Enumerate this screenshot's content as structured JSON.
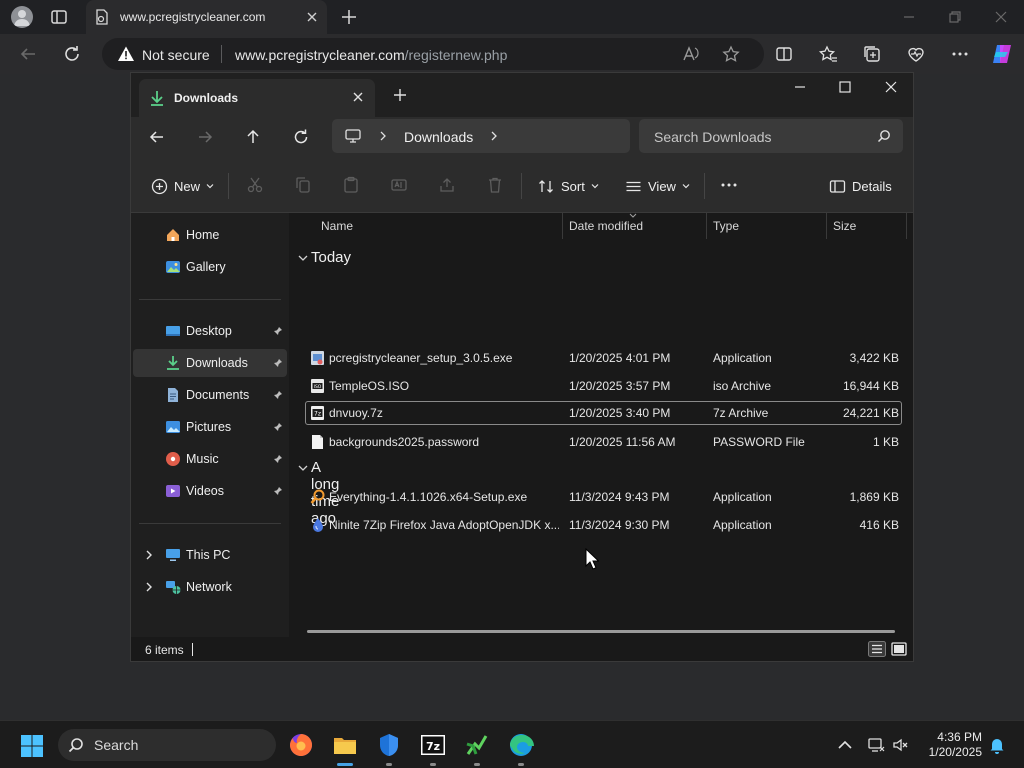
{
  "browser": {
    "tab_title": "www.pcregistrycleaner.com",
    "security_label": "Not secure",
    "url_host": "www.pcregistrycleaner.com",
    "url_path": "/registernew.php"
  },
  "explorer": {
    "tab_title": "Downloads",
    "breadcrumb": "Downloads",
    "search_placeholder": "Search Downloads",
    "toolbar": {
      "new_label": "New",
      "sort_label": "Sort",
      "view_label": "View",
      "details_label": "Details"
    },
    "sidebar": {
      "quick": [
        {
          "label": "Home",
          "icon": "home-icon"
        },
        {
          "label": "Gallery",
          "icon": "gallery-icon"
        }
      ],
      "pinned": [
        {
          "label": "Desktop",
          "icon": "desktop-icon"
        },
        {
          "label": "Downloads",
          "icon": "downloads-icon"
        },
        {
          "label": "Documents",
          "icon": "documents-icon"
        },
        {
          "label": "Pictures",
          "icon": "pictures-icon"
        },
        {
          "label": "Music",
          "icon": "music-icon"
        },
        {
          "label": "Videos",
          "icon": "videos-icon"
        }
      ],
      "locations": [
        {
          "label": "This PC",
          "icon": "this-pc-icon"
        },
        {
          "label": "Network",
          "icon": "network-icon"
        }
      ]
    },
    "columns": [
      "Name",
      "Date modified",
      "Type",
      "Size"
    ],
    "groups": [
      {
        "label": "Today",
        "files": [
          {
            "name": "pcregistrycleaner_setup_3.0.5.exe",
            "date": "1/20/2025 4:01 PM",
            "type": "Application",
            "size": "3,422 KB",
            "icon": "installer-icon"
          },
          {
            "name": "TempleOS.ISO",
            "date": "1/20/2025 3:57 PM",
            "type": "iso Archive",
            "size": "16,944 KB",
            "icon": "iso-icon"
          },
          {
            "name": "dnvuoy.7z",
            "date": "1/20/2025 3:40 PM",
            "type": "7z Archive",
            "size": "24,221 KB",
            "icon": "7z-archive-icon"
          },
          {
            "name": "backgrounds2025.password",
            "date": "1/20/2025 11:56 AM",
            "type": "PASSWORD File",
            "size": "1 KB",
            "icon": "generic-file-icon"
          }
        ]
      },
      {
        "label": "A long time ago",
        "files": [
          {
            "name": "Everything-1.4.1.1026.x64-Setup.exe",
            "date": "11/3/2024 9:43 PM",
            "type": "Application",
            "size": "1,869 KB",
            "icon": "everything-icon"
          },
          {
            "name": "Ninite 7Zip Firefox Java AdoptOpenJDK x...",
            "date": "11/3/2024 9:30 PM",
            "type": "Application",
            "size": "416 KB",
            "icon": "ninite-icon"
          }
        ]
      }
    ],
    "status": "6 items"
  },
  "taskbar": {
    "search_placeholder": "Search",
    "time": "4:36 PM",
    "date": "1/20/2025"
  },
  "colors": {
    "accent": "#47a3e6",
    "folder": "#f0c14b"
  }
}
